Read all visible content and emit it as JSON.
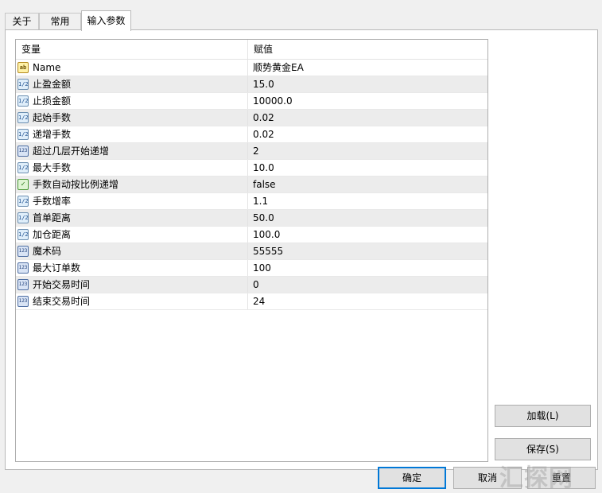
{
  "tabs": [
    {
      "label": "关于"
    },
    {
      "label": "常用"
    },
    {
      "label": "输入参数",
      "active": true
    }
  ],
  "grid": {
    "headers": {
      "variable": "变量",
      "value": "赋值"
    },
    "rows": [
      {
        "icon": "ab",
        "name": "Name",
        "value": "顺势黄金EA"
      },
      {
        "icon": "1/2",
        "name": "止盈金额",
        "value": "15.0"
      },
      {
        "icon": "1/2",
        "name": "止损金额",
        "value": "10000.0"
      },
      {
        "icon": "1/2",
        "name": "起始手数",
        "value": "0.02"
      },
      {
        "icon": "1/2",
        "name": "递增手数",
        "value": "0.02"
      },
      {
        "icon": "123",
        "name": "超过几层开始递增",
        "value": "2"
      },
      {
        "icon": "1/2",
        "name": "最大手数",
        "value": "10.0"
      },
      {
        "icon": "bool",
        "name": "手数自动按比例递增",
        "value": "false"
      },
      {
        "icon": "1/2",
        "name": "手数增率",
        "value": "1.1"
      },
      {
        "icon": "1/2",
        "name": "首单距离",
        "value": "50.0"
      },
      {
        "icon": "1/2",
        "name": "加仓距离",
        "value": "100.0"
      },
      {
        "icon": "123",
        "name": "魔术码",
        "value": "55555"
      },
      {
        "icon": "123",
        "name": "最大订单数",
        "value": "100"
      },
      {
        "icon": "123",
        "name": "开始交易时间",
        "value": "0"
      },
      {
        "icon": "123",
        "name": "结束交易时间",
        "value": "24"
      }
    ]
  },
  "buttons": {
    "load": "加载(L)",
    "save": "保存(S)",
    "ok": "确定",
    "cancel": "取消",
    "reset": "重置"
  },
  "watermark": "汇探网"
}
